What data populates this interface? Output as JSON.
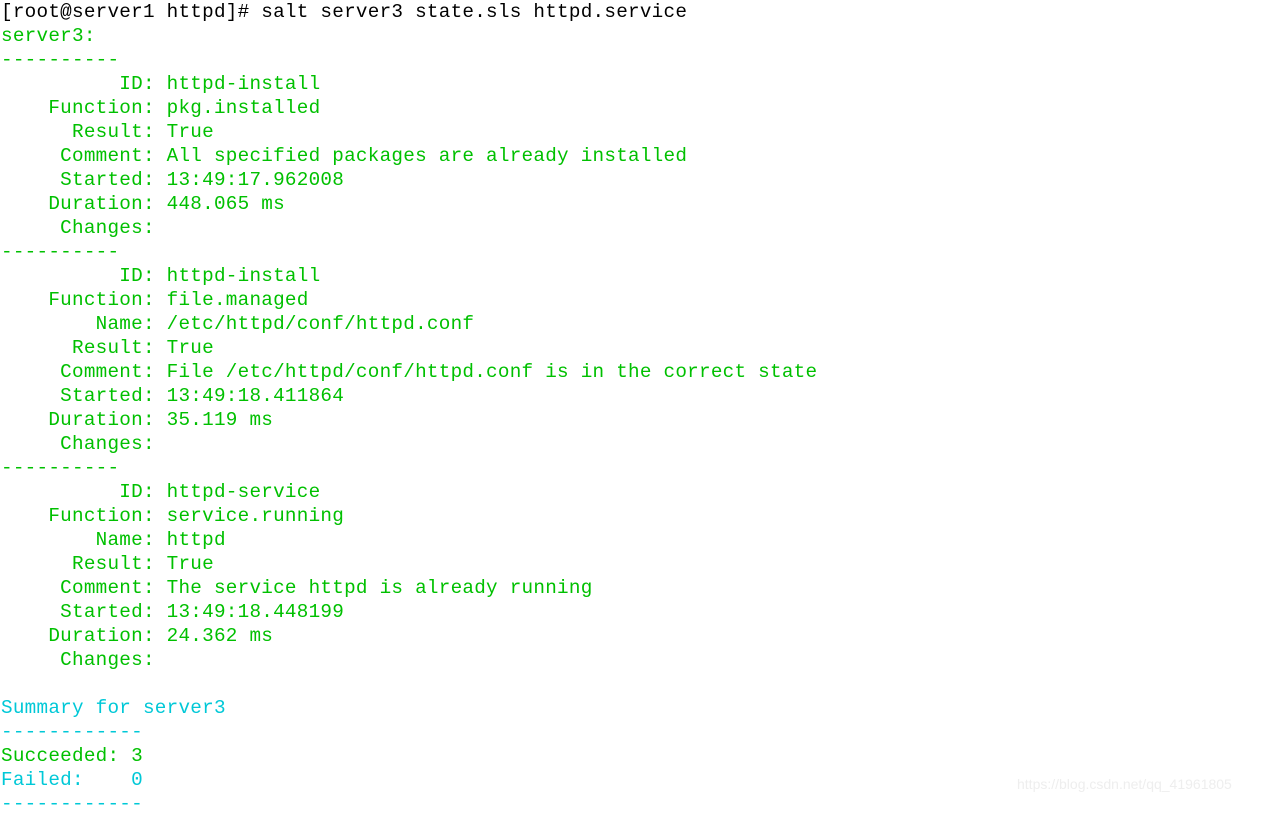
{
  "terminal": {
    "prompt_line": "[root@server1 httpd]# salt server3 state.sls httpd.service",
    "minion_header": "server3:",
    "separator": "----------",
    "summary_separator": "------------",
    "blocks": [
      {
        "id_line": "          ID: httpd-install",
        "function_line": "    Function: pkg.installed",
        "result_line": "      Result: True",
        "comment_line": "     Comment: All specified packages are already installed",
        "started_line": "     Started: 13:49:17.962008",
        "duration_line": "    Duration: 448.065 ms",
        "changes_line": "     Changes:"
      },
      {
        "id_line": "          ID: httpd-install",
        "function_line": "    Function: file.managed",
        "name_line": "        Name: /etc/httpd/conf/httpd.conf",
        "result_line": "      Result: True",
        "comment_line": "     Comment: File /etc/httpd/conf/httpd.conf is in the correct state",
        "started_line": "     Started: 13:49:18.411864",
        "duration_line": "    Duration: 35.119 ms",
        "changes_line": "     Changes:"
      },
      {
        "id_line": "          ID: httpd-service",
        "function_line": "    Function: service.running",
        "name_line": "        Name: httpd",
        "result_line": "      Result: True",
        "comment_line": "     Comment: The service httpd is already running",
        "started_line": "     Started: 13:49:18.448199",
        "duration_line": "    Duration: 24.362 ms",
        "changes_line": "     Changes:"
      }
    ],
    "summary": {
      "title": "Summary for server3",
      "succeeded": "Succeeded: 3",
      "failed": "Failed:    0"
    },
    "colors": {
      "prompt": "#000000",
      "success_green": "#00c000",
      "summary_cyan": "#00c8d7",
      "background": "#ffffff"
    }
  },
  "watermark": {
    "text": "https://blog.csdn.net/qq_41961805"
  }
}
